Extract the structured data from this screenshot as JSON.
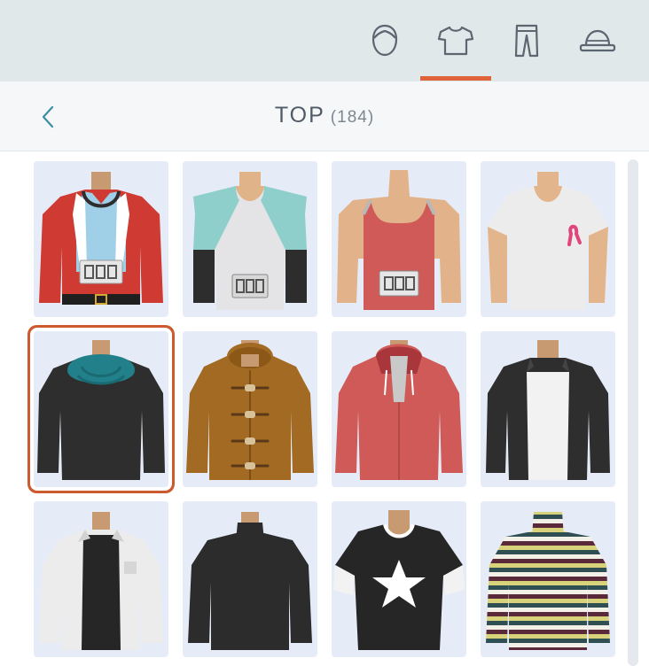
{
  "tabs": [
    {
      "name": "face-icon",
      "active": false
    },
    {
      "name": "shirt-icon",
      "active": true
    },
    {
      "name": "pants-icon",
      "active": false
    },
    {
      "name": "hat-icon",
      "active": false
    }
  ],
  "header": {
    "title": "TOP",
    "count": "(184)"
  },
  "colors": {
    "accent": "#e0643a",
    "selected_border": "#cc5a2e",
    "card_bg": "#e6ecf7",
    "icon": "#5c6670",
    "back": "#3a8fa5"
  },
  "items": [
    {
      "name": "red-jacket-race-bib"
    },
    {
      "name": "raglan-shirt-race-bib"
    },
    {
      "name": "red-tank-top-race-bib"
    },
    {
      "name": "white-tshirt-pink-ribbon"
    },
    {
      "name": "black-sweater-teal-scarf",
      "selected": true
    },
    {
      "name": "brown-duffle-coat"
    },
    {
      "name": "red-hoodie"
    },
    {
      "name": "black-blazer-white-shirt"
    },
    {
      "name": "white-shirt-black-tee"
    },
    {
      "name": "black-turtleneck"
    },
    {
      "name": "black-tshirt-star"
    },
    {
      "name": "striped-turtleneck"
    }
  ]
}
